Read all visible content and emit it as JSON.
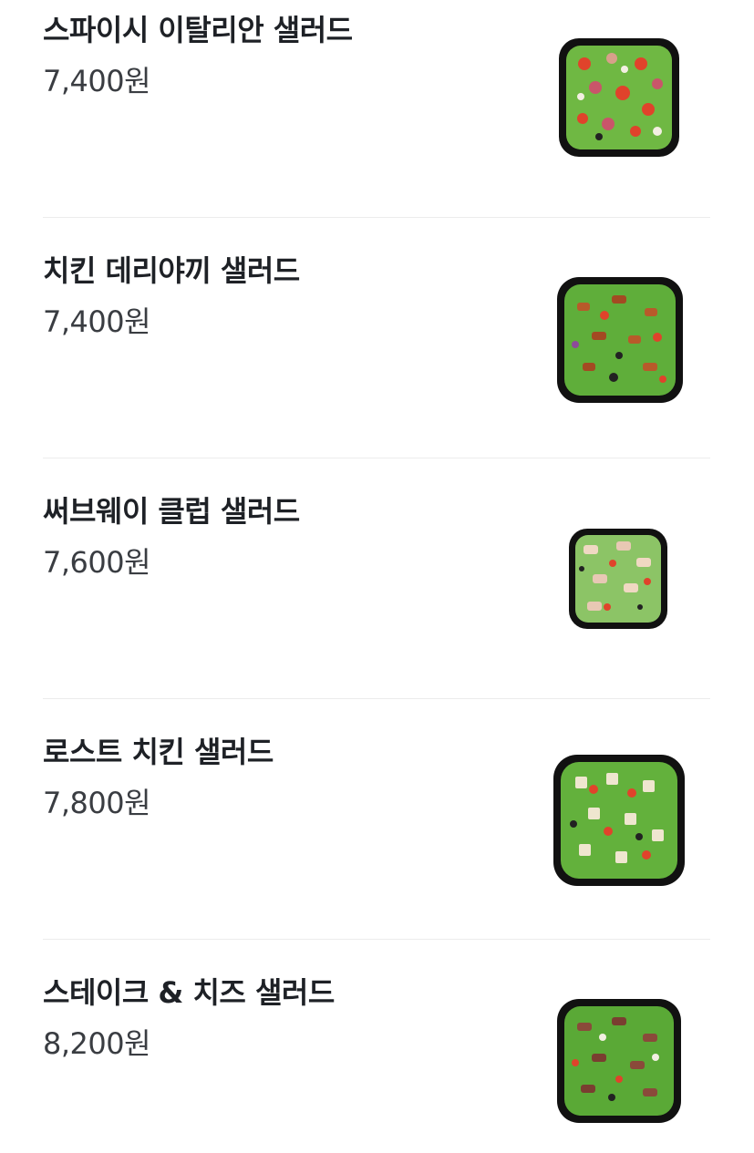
{
  "menu": {
    "items": [
      {
        "name": "스파이시 이탈리안 샐러드",
        "price": "7,400원",
        "image": "spicy-italian-salad-bowl"
      },
      {
        "name": "치킨 데리야끼 샐러드",
        "price": "7,400원",
        "image": "chicken-teriyaki-salad-bowl"
      },
      {
        "name": "써브웨이 클럽 샐러드",
        "price": "7,600원",
        "image": "subway-club-salad-bowl"
      },
      {
        "name": "로스트 치킨 샐러드",
        "price": "7,800원",
        "image": "roast-chicken-salad-bowl"
      },
      {
        "name": "스테이크 & 치즈 샐러드",
        "price": "8,200원",
        "image": "steak-cheese-salad-bowl"
      }
    ]
  },
  "colors": {
    "title_text": "#1e2126",
    "price_text": "#3a3d42",
    "divider": "#ececec",
    "lettuce": "#5fae3a",
    "tomato": "#e0432b",
    "bowl": "#111111"
  }
}
